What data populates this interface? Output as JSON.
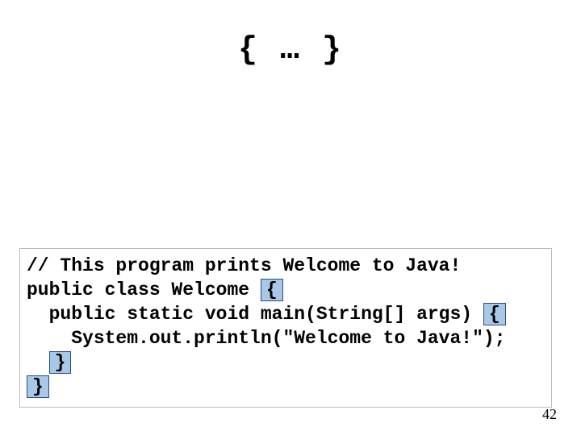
{
  "title": "{ … }",
  "code": {
    "line1": "// This program prints Welcome to Java! ",
    "line2_pre": "public class Welcome ",
    "line2_brace": "{",
    "line3_pre": "  public static void main(String[] args) ",
    "line3_brace": "{",
    "line4": "    System.out.println(\"Welcome to Java!\");",
    "line5_indent": "  ",
    "line5_brace": "}",
    "line6_brace": "}"
  },
  "page_number": "42"
}
